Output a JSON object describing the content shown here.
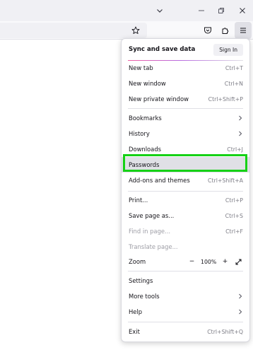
{
  "menu": {
    "sync_label": "Sync and save data",
    "signin_label": "Sign In",
    "items": [
      {
        "label": "New tab",
        "shortcut": "Ctrl+T"
      },
      {
        "label": "New window",
        "shortcut": "Ctrl+N"
      },
      {
        "label": "New private window",
        "shortcut": "Ctrl+Shift+P"
      },
      {
        "label": "Bookmarks",
        "shortcut": ""
      },
      {
        "label": "History",
        "shortcut": ""
      },
      {
        "label": "Downloads",
        "shortcut": "Ctrl+J"
      },
      {
        "label": "Passwords",
        "shortcut": ""
      },
      {
        "label": "Add-ons and themes",
        "shortcut": "Ctrl+Shift+A"
      },
      {
        "label": "Print...",
        "shortcut": "Ctrl+P"
      },
      {
        "label": "Save page as...",
        "shortcut": "Ctrl+S"
      },
      {
        "label": "Find in page...",
        "shortcut": "Ctrl+F"
      },
      {
        "label": "Translate page...",
        "shortcut": ""
      },
      {
        "label": "Zoom",
        "shortcut": ""
      },
      {
        "label": "Settings",
        "shortcut": ""
      },
      {
        "label": "More tools",
        "shortcut": ""
      },
      {
        "label": "Help",
        "shortcut": ""
      },
      {
        "label": "Exit",
        "shortcut": "Ctrl+Shift+Q"
      }
    ],
    "zoom_level": "100%",
    "zoom_minus": "−",
    "zoom_plus": "+"
  },
  "colors": {
    "highlight_border": "#16d116",
    "hover_bg": "#e0e0e6"
  }
}
